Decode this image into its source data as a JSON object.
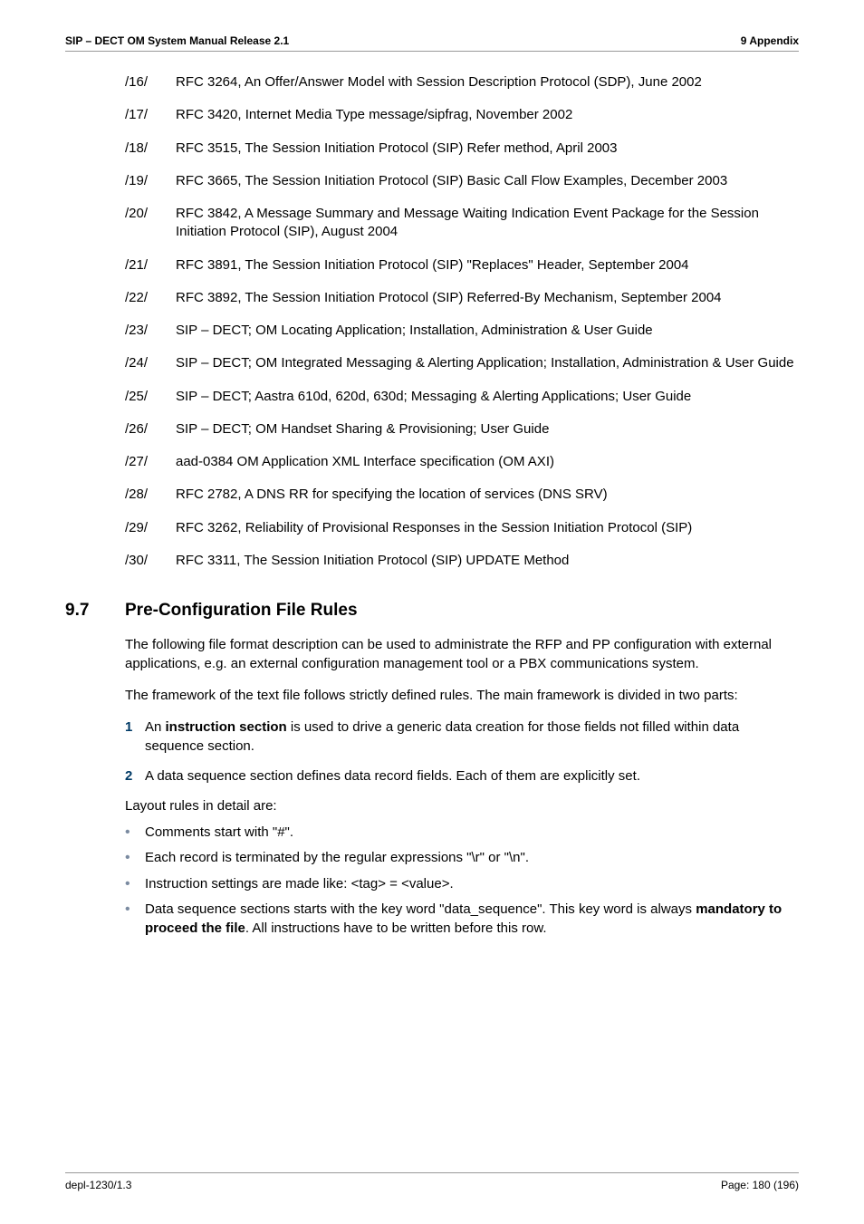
{
  "header": {
    "left": "SIP – DECT OM System Manual Release 2.1",
    "right": "9 Appendix"
  },
  "references": [
    {
      "num": "/16/",
      "text": "RFC 3264, An Offer/Answer Model with Session Description Protocol (SDP), June 2002"
    },
    {
      "num": "/17/",
      "text": "RFC 3420, Internet Media Type message/sipfrag, November 2002"
    },
    {
      "num": "/18/",
      "text": "RFC 3515, The Session Initiation Protocol (SIP) Refer method, April 2003"
    },
    {
      "num": "/19/",
      "text": "RFC 3665, The Session Initiation Protocol (SIP) Basic Call Flow Examples, December 2003"
    },
    {
      "num": "/20/",
      "text": "RFC 3842, A Message Summary and Message Waiting Indication Event Package for the Session Initiation Protocol (SIP), August 2004"
    },
    {
      "num": "/21/",
      "text": "RFC 3891, The Session Initiation Protocol (SIP) \"Replaces\" Header, September 2004"
    },
    {
      "num": "/22/",
      "text": "RFC 3892, The Session Initiation Protocol (SIP) Referred-By Mechanism, September 2004"
    },
    {
      "num": "/23/",
      "text": "SIP – DECT; OM Locating Application; Installation, Administration & User Guide"
    },
    {
      "num": "/24/",
      "text": "SIP – DECT; OM Integrated Messaging & Alerting Application; Installation, Administration & User Guide"
    },
    {
      "num": "/25/",
      "text": "SIP – DECT; Aastra 610d, 620d, 630d; Messaging & Alerting Applications; User Guide"
    },
    {
      "num": "/26/",
      "text": "SIP – DECT; OM Handset Sharing & Provisioning; User Guide"
    },
    {
      "num": "/27/",
      "text": "aad-0384 OM Application XML Interface specification (OM AXI)"
    },
    {
      "num": "/28/",
      "text": "RFC 2782, A DNS RR for specifying the location of services (DNS SRV)"
    },
    {
      "num": "/29/",
      "text": "RFC 3262, Reliability of Provisional Responses in the Session Initiation Protocol (SIP)"
    },
    {
      "num": "/30/",
      "text": "RFC 3311, The Session Initiation Protocol (SIP) UPDATE Method"
    }
  ],
  "section": {
    "number": "9.7",
    "title": "Pre-Configuration File Rules",
    "para1": "The following file format description can be used to administrate the RFP and PP configuration with external applications, e.g. an external configuration management tool or a PBX communications system.",
    "para2": "The framework of the text file follows strictly defined rules. The main framework is divided in two parts:",
    "numbered": [
      {
        "marker": "1",
        "prefix": "An ",
        "bold": "instruction section",
        "suffix": " is used to drive a generic data creation for those fields not filled within data sequence section."
      },
      {
        "marker": "2",
        "prefix": "",
        "bold": "",
        "suffix": "A data sequence section defines data record fields. Each of them are explicitly set."
      }
    ],
    "para3": "Layout rules in detail are:",
    "bullets": [
      {
        "text": "Comments start with \"#\"."
      },
      {
        "text": "Each record is terminated by the regular expressions \"\\r\" or \"\\n\"."
      },
      {
        "text": "Instruction settings are made like: <tag> = <value>."
      },
      {
        "prefix": "Data sequence sections starts with the key word \"data_sequence\". This key word is always ",
        "bold": "mandatory to proceed the file",
        "suffix": ". All instructions have to be written before this row."
      }
    ]
  },
  "footer": {
    "left": "depl-1230/1.3",
    "right": "Page: 180 (196)"
  }
}
